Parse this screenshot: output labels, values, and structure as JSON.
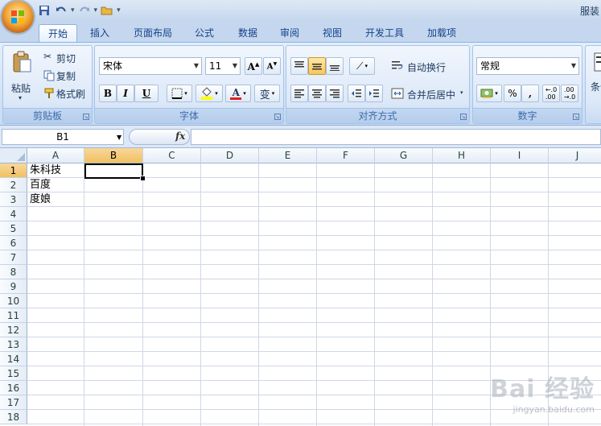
{
  "app": {
    "title": "服装"
  },
  "tabs": [
    "开始",
    "插入",
    "页面布局",
    "公式",
    "数据",
    "审阅",
    "视图",
    "开发工具",
    "加载项"
  ],
  "ribbon": {
    "clipboard": {
      "paste": "粘贴",
      "cut": "剪切",
      "copy": "复制",
      "format_painter": "格式刷",
      "label": "剪贴板"
    },
    "font": {
      "name": "宋体",
      "size": "11",
      "label": "字体",
      "bold": "B",
      "italic": "I",
      "underline": "U",
      "font_color": "A",
      "phonetic": "变"
    },
    "alignment": {
      "wrap": "自动换行",
      "merge": "合并后居中",
      "label": "对齐方式"
    },
    "number": {
      "format": "常规",
      "percent": "%",
      "comma": ",",
      "label": "数字"
    },
    "styles": {
      "cond_partial": "条件"
    }
  },
  "formula_bar": {
    "name_box": "B1",
    "fx": "fx",
    "value": ""
  },
  "sheet": {
    "columns": [
      "A",
      "B",
      "C",
      "D",
      "E",
      "F",
      "G",
      "H",
      "I",
      "J"
    ],
    "rows": [
      "1",
      "2",
      "3",
      "4",
      "5",
      "6",
      "7",
      "8",
      "9",
      "10",
      "11",
      "12",
      "13",
      "14",
      "15",
      "16",
      "17",
      "18"
    ],
    "selected": {
      "col": "B",
      "row": "1"
    },
    "cells": [
      {
        "ref": "A1",
        "col": "A",
        "row": "1",
        "value": "朱科技"
      },
      {
        "ref": "A2",
        "col": "A",
        "row": "2",
        "value": "百度"
      },
      {
        "ref": "A3",
        "col": "A",
        "row": "3",
        "value": "度娘"
      }
    ]
  },
  "watermark": {
    "main": "Bai 经验",
    "sub": "jingyan.baidu.com"
  },
  "colors": {
    "ribbon": "#dbe7f7",
    "accent": "#15428b",
    "selection": "#f8d79b"
  }
}
